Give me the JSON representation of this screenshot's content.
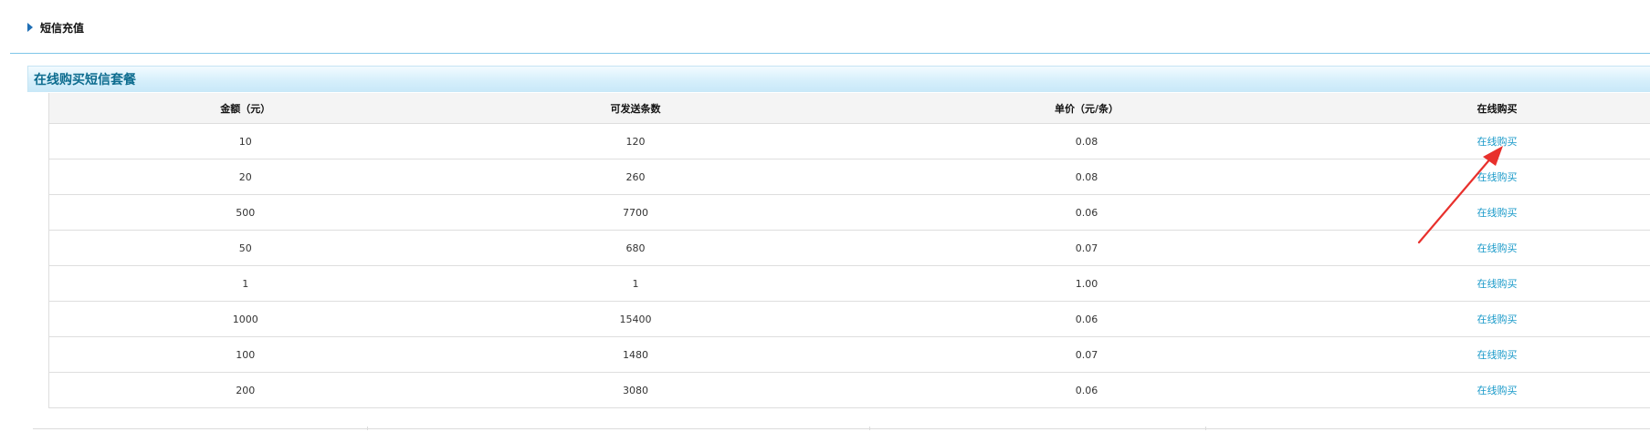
{
  "header": {
    "title": "短信充值"
  },
  "section": {
    "title": "在线购买短信套餐"
  },
  "table": {
    "columns": [
      "金额（元）",
      "可发送条数",
      "单价（元/条）",
      "在线购买"
    ],
    "rows": [
      {
        "amount": "10",
        "count": "120",
        "price": "0.08",
        "action": "在线购买"
      },
      {
        "amount": "20",
        "count": "260",
        "price": "0.08",
        "action": "在线购买"
      },
      {
        "amount": "500",
        "count": "7700",
        "price": "0.06",
        "action": "在线购买"
      },
      {
        "amount": "50",
        "count": "680",
        "price": "0.07",
        "action": "在线购买"
      },
      {
        "amount": "1",
        "count": "1",
        "price": "1.00",
        "action": "在线购买"
      },
      {
        "amount": "1000",
        "count": "15400",
        "price": "0.06",
        "action": "在线购买"
      },
      {
        "amount": "100",
        "count": "1480",
        "price": "0.07",
        "action": "在线购买"
      },
      {
        "amount": "200",
        "count": "3080",
        "price": "0.06",
        "action": "在线购买"
      }
    ]
  },
  "colors": {
    "accent": "#1a9ac9",
    "section_title": "#0d6c8f",
    "annotation": "#e8302c"
  }
}
